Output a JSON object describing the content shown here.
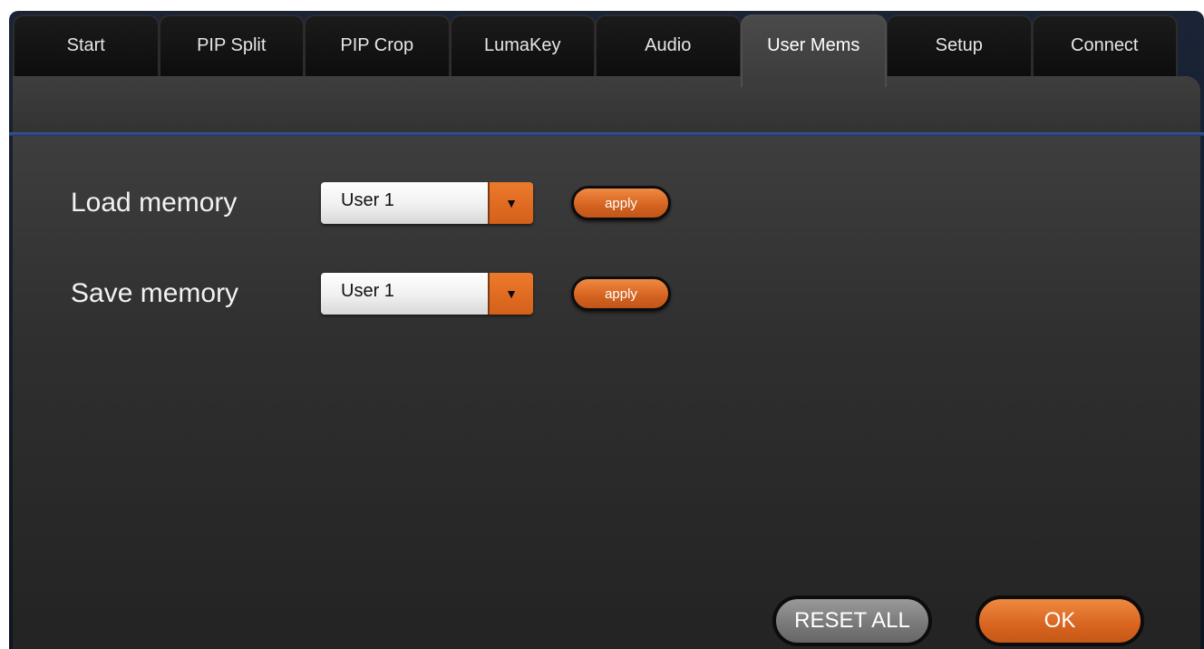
{
  "tabs": [
    {
      "label": "Start"
    },
    {
      "label": "PIP Split"
    },
    {
      "label": "PIP Crop"
    },
    {
      "label": "LumaKey"
    },
    {
      "label": "Audio"
    },
    {
      "label": "User Mems",
      "active": true
    },
    {
      "label": "Setup"
    },
    {
      "label": "Connect"
    }
  ],
  "load": {
    "label": "Load memory",
    "selected": "User 1",
    "apply_label": "apply"
  },
  "save": {
    "label": "Save memory",
    "selected": "User 1",
    "apply_label": "apply"
  },
  "footer": {
    "reset_label": "RESET ALL",
    "ok_label": "OK"
  },
  "colors": {
    "accent": "#d8641f",
    "rule": "#2f4c8c"
  },
  "icons": {
    "dropdown": "chevron-down-icon"
  }
}
